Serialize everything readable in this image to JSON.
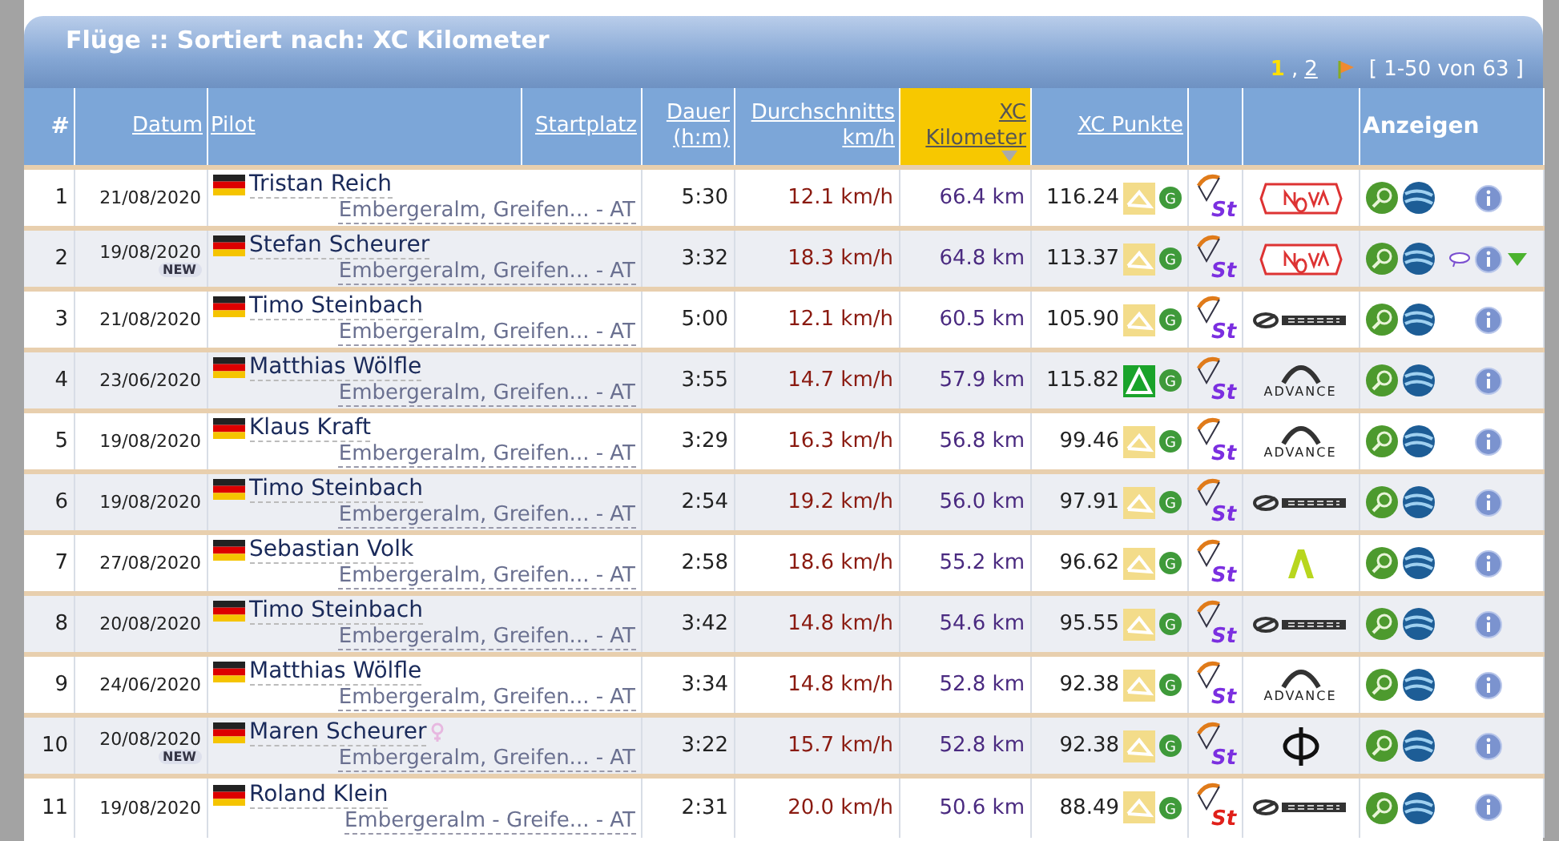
{
  "title": "Flüge :: Sortiert nach: XC Kilometer",
  "pagination": {
    "pages": [
      {
        "label": "1",
        "selected": true
      },
      {
        "label": "2",
        "selected": false
      }
    ],
    "separator": ",",
    "range": "[ 1-50 von 63 ]"
  },
  "columns": [
    {
      "label": "#",
      "link": false,
      "sorted": false
    },
    {
      "label": "Datum",
      "link": true,
      "sorted": false
    },
    {
      "label": "Pilot",
      "link": true,
      "sorted": false
    },
    {
      "label": "Startplatz",
      "link": true,
      "sorted": false
    },
    {
      "label": "Dauer (h:m)",
      "link": true,
      "sorted": false
    },
    {
      "label": "Durchschnitts km/h",
      "link": true,
      "sorted": false
    },
    {
      "label": "XC Kilometer",
      "link": true,
      "sorted": true
    },
    {
      "label": "XC Punkte",
      "link": true,
      "sorted": false
    },
    {
      "sorted": false
    },
    {
      "sorted": false
    },
    {
      "label": "Anzeigen",
      "link": false,
      "sorted": false
    }
  ],
  "rows": [
    {
      "rank": "1",
      "date": "21/08/2020",
      "new": false,
      "pilot": "Tristan Reich",
      "female": false,
      "site": "Embergeralm, Greifen... - AT",
      "duration": "5:30",
      "speed": "12.1 km/h",
      "km": "66.4 km",
      "points": "116.24",
      "route": {
        "kind": "free"
      },
      "g": "G",
      "class": {
        "label": "St",
        "color": "#7b2fe0"
      },
      "brand": {
        "kind": "nova"
      },
      "comment": false,
      "expand": false
    },
    {
      "rank": "2",
      "date": "19/08/2020",
      "new": true,
      "new_label": "NEW",
      "pilot": "Stefan Scheurer",
      "female": false,
      "site": "Embergeralm, Greifen... - AT",
      "duration": "3:32",
      "speed": "18.3 km/h",
      "km": "64.8 km",
      "points": "113.37",
      "route": {
        "kind": "free"
      },
      "g": "G",
      "class": {
        "label": "St",
        "color": "#7b2fe0"
      },
      "brand": {
        "kind": "nova"
      },
      "comment": true,
      "expand": true
    },
    {
      "rank": "3",
      "date": "21/08/2020",
      "new": false,
      "pilot": "Timo Steinbach",
      "female": false,
      "site": "Embergeralm, Greifen... - AT",
      "duration": "5:00",
      "speed": "12.1 km/h",
      "km": "60.5 km",
      "points": "105.90",
      "route": {
        "kind": "free"
      },
      "g": "G",
      "class": {
        "label": "St",
        "color": "#7b2fe0"
      },
      "brand": {
        "kind": "ozone"
      },
      "comment": false,
      "expand": false
    },
    {
      "rank": "4",
      "date": "23/06/2020",
      "new": false,
      "pilot": "Matthias Wölfle",
      "female": false,
      "site": "Embergeralm, Greifen... - AT",
      "duration": "3:55",
      "speed": "14.7 km/h",
      "km": "57.9 km",
      "points": "115.82",
      "route": {
        "kind": "fai"
      },
      "g": "G",
      "class": {
        "label": "St",
        "color": "#7b2fe0"
      },
      "brand": {
        "kind": "advance",
        "text": "ADVANCE"
      },
      "comment": false,
      "expand": false
    },
    {
      "rank": "5",
      "date": "19/08/2020",
      "new": false,
      "pilot": "Klaus Kraft",
      "female": false,
      "site": "Embergeralm, Greifen... - AT",
      "duration": "3:29",
      "speed": "16.3 km/h",
      "km": "56.8 km",
      "points": "99.46",
      "route": {
        "kind": "free"
      },
      "g": "G",
      "class": {
        "label": "St",
        "color": "#7b2fe0"
      },
      "brand": {
        "kind": "advance",
        "text": "ADVANCE"
      },
      "comment": false,
      "expand": false
    },
    {
      "rank": "6",
      "date": "19/08/2020",
      "new": false,
      "pilot": "Timo Steinbach",
      "female": false,
      "site": "Embergeralm, Greifen... - AT",
      "duration": "2:54",
      "speed": "19.2 km/h",
      "km": "56.0 km",
      "points": "97.91",
      "route": {
        "kind": "free"
      },
      "g": "G",
      "class": {
        "label": "St",
        "color": "#7b2fe0"
      },
      "brand": {
        "kind": "ozone"
      },
      "comment": false,
      "expand": false
    },
    {
      "rank": "7",
      "date": "27/08/2020",
      "new": false,
      "pilot": "Sebastian Volk",
      "female": false,
      "site": "Embergeralm, Greifen... - AT",
      "duration": "2:58",
      "speed": "18.6 km/h",
      "km": "55.2 km",
      "points": "96.62",
      "route": {
        "kind": "free"
      },
      "g": "G",
      "class": {
        "label": "St",
        "color": "#7b2fe0"
      },
      "brand": {
        "kind": "lambda"
      },
      "comment": false,
      "expand": false
    },
    {
      "rank": "8",
      "date": "20/08/2020",
      "new": false,
      "pilot": "Timo Steinbach",
      "female": false,
      "site": "Embergeralm, Greifen... - AT",
      "duration": "3:42",
      "speed": "14.8 km/h",
      "km": "54.6 km",
      "points": "95.55",
      "route": {
        "kind": "free"
      },
      "g": "G",
      "class": {
        "label": "St",
        "color": "#7b2fe0"
      },
      "brand": {
        "kind": "ozone"
      },
      "comment": false,
      "expand": false
    },
    {
      "rank": "9",
      "date": "24/06/2020",
      "new": false,
      "pilot": "Matthias Wölfle",
      "female": false,
      "site": "Embergeralm, Greifen... - AT",
      "duration": "3:34",
      "speed": "14.8 km/h",
      "km": "52.8 km",
      "points": "92.38",
      "route": {
        "kind": "free"
      },
      "g": "G",
      "class": {
        "label": "St",
        "color": "#7b2fe0"
      },
      "brand": {
        "kind": "advance",
        "text": "ADVANCE"
      },
      "comment": false,
      "expand": false
    },
    {
      "rank": "10",
      "date": "20/08/2020",
      "new": true,
      "new_label": "NEW",
      "pilot": "Maren Scheurer",
      "female": true,
      "site": "Embergeralm, Greifen... - AT",
      "duration": "3:22",
      "speed": "15.7 km/h",
      "km": "52.8 km",
      "points": "92.38",
      "route": {
        "kind": "free"
      },
      "g": "G",
      "class": {
        "label": "St",
        "color": "#7b2fe0"
      },
      "brand": {
        "kind": "phi"
      },
      "comment": false,
      "expand": false
    },
    {
      "rank": "11",
      "date": "19/08/2020",
      "new": false,
      "pilot": "Roland Klein",
      "female": false,
      "site": "Embergeralm - Greife... - AT",
      "duration": "2:31",
      "speed": "20.0 km/h",
      "km": "50.6 km",
      "points": "88.49",
      "route": {
        "kind": "free"
      },
      "g": "G",
      "class": {
        "label": "St",
        "color": "#e0201a"
      },
      "brand": {
        "kind": "ozone"
      },
      "comment": false,
      "expand": false
    }
  ]
}
